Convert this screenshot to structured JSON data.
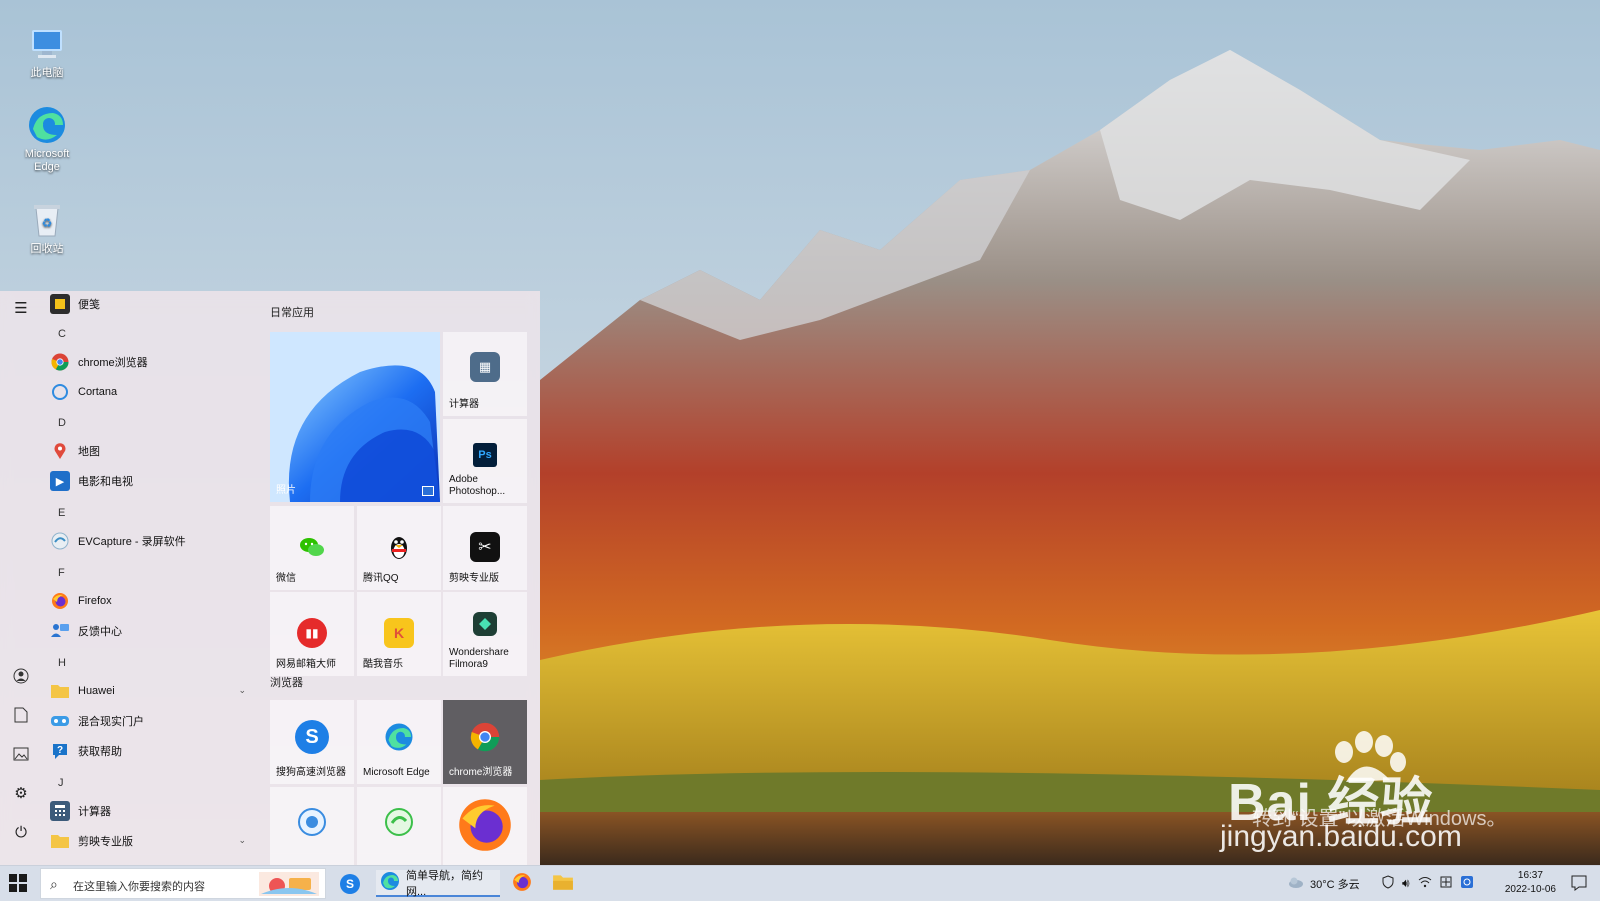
{
  "desktop": {
    "icons": [
      {
        "label": "此电脑",
        "icon": "computer-icon"
      },
      {
        "label": "Microsoft Edge",
        "icon": "edge-icon"
      },
      {
        "label": "回收站",
        "icon": "recycle-bin-icon"
      }
    ]
  },
  "start_menu": {
    "apps": [
      {
        "label": "便笺",
        "icon": "sticky-notes-icon",
        "color": "#f3c21a"
      },
      {
        "letter": "C"
      },
      {
        "label": "chrome浏览器",
        "icon": "chrome-icon"
      },
      {
        "label": "Cortana",
        "icon": "cortana-icon"
      },
      {
        "letter": "D"
      },
      {
        "label": "地图",
        "icon": "map-pin-icon",
        "color": "#e04a3c"
      },
      {
        "label": "电影和电视",
        "icon": "movies-icon",
        "color": "#1f6fc9"
      },
      {
        "letter": "E"
      },
      {
        "label": "EVCapture - 录屏软件",
        "icon": "evcapture-icon"
      },
      {
        "letter": "F"
      },
      {
        "label": "Firefox",
        "icon": "firefox-icon"
      },
      {
        "label": "反馈中心",
        "icon": "feedback-icon",
        "color": "#2a74d1"
      },
      {
        "letter": "H"
      },
      {
        "label": "Huawei",
        "icon": "folder-icon",
        "expandable": true
      },
      {
        "label": "混合现实门户",
        "icon": "mixed-reality-icon"
      },
      {
        "label": "获取帮助",
        "icon": "help-icon",
        "color": "#1a73c9"
      },
      {
        "letter": "J"
      },
      {
        "label": "计算器",
        "icon": "calculator-icon",
        "color": "#3c5a7a"
      },
      {
        "label": "剪映专业版",
        "icon": "folder-icon",
        "expandable": true
      }
    ],
    "groups": [
      {
        "title": "日常应用"
      },
      {
        "title": "浏览器"
      }
    ],
    "tiles": {
      "photos": "照片",
      "calculator": "计算器",
      "photoshop_line1": "Adobe",
      "photoshop_line2": "Photoshop...",
      "wechat": "微信",
      "qq": "腾讯QQ",
      "jianying": "剪映专业版",
      "mail": "网易邮箱大师",
      "kuwo": "酷我音乐",
      "filmora_line1": "Wondershare",
      "filmora_line2": "Filmora9",
      "sogou": "搜狗高速浏览器",
      "edge": "Microsoft Edge",
      "chrome": "chrome浏览器",
      "ps_badge": "Ps"
    }
  },
  "taskbar": {
    "search_placeholder": "在这里输入你要搜索的内容",
    "active_task": "简单导航，简约网...",
    "weather": "30°C 多云",
    "clock_time": "16:37",
    "clock_date": "2022-10-06"
  },
  "watermark": {
    "brand": "Bai 经验",
    "sub": "转到“设置”以激活Windows。",
    "url": "jingyan.baidu.com"
  }
}
